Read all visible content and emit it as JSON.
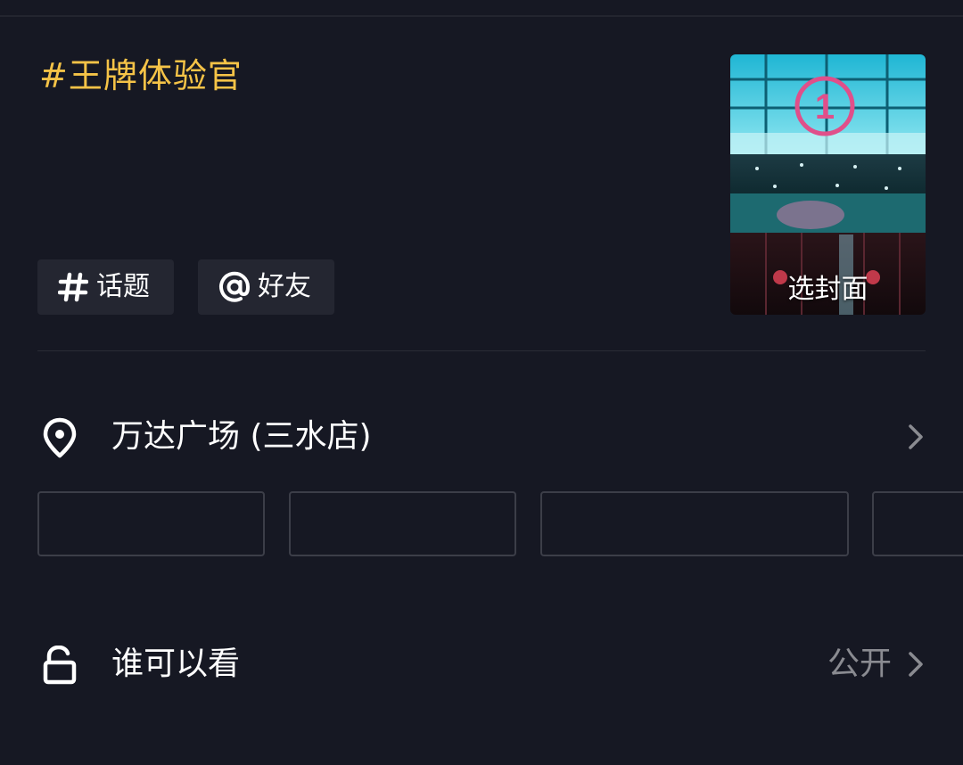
{
  "caption": {
    "text": "#王牌体验官",
    "color": "#f5c347"
  },
  "chips": [
    {
      "icon": "hashtag-icon",
      "label": "话题"
    },
    {
      "icon": "at-icon",
      "label": "好友"
    }
  ],
  "cover": {
    "label": "选封面"
  },
  "location": {
    "icon": "location-pin-icon",
    "label": "万达广场 (三水店)",
    "chevron": "chevron-right-icon"
  },
  "poi_suggestions": [
    {
      "label": ""
    },
    {
      "label": ""
    },
    {
      "label": ""
    },
    {
      "label": ""
    }
  ],
  "privacy": {
    "icon": "unlock-icon",
    "label": "谁可以看",
    "value": "公开",
    "chevron": "chevron-right-icon"
  },
  "colors": {
    "background": "#161823",
    "chip_background": "#242631",
    "secondary_text": "#8a8b91"
  }
}
